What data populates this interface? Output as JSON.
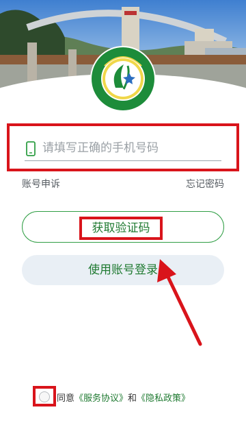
{
  "header": {
    "logo_alt": "university emblem",
    "colors": {
      "sky": "#4f8fd6",
      "green": "#2f9e44",
      "logo_ring": "#1d8c3a"
    }
  },
  "login": {
    "phone_placeholder": "请填写正确的手机号码",
    "appeal_link": "账号申诉",
    "forgot_link": "忘记密码",
    "get_code_button": "获取验证码",
    "account_login_button": "使用账号登录"
  },
  "agreement": {
    "prefix": "同意",
    "service_link": "《服务协议》",
    "and": "和",
    "privacy_link": "《隐私政策》"
  },
  "colors": {
    "accent_green": "#1f7a31",
    "annotation_red": "#d9141b",
    "secondary_button_bg": "#e9eff5"
  }
}
